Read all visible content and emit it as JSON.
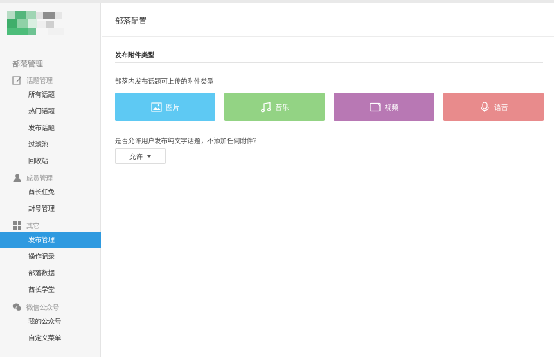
{
  "sidebar": {
    "title": "部落管理",
    "groups": [
      {
        "label": "话题管理",
        "icon": "edit-icon"
      },
      {
        "label": "成员管理",
        "icon": "user-icon"
      },
      {
        "label": "其它",
        "icon": "grid-icon"
      },
      {
        "label": "微信公众号",
        "icon": "wechat-icon"
      }
    ],
    "items": [
      "所有话题",
      "热门话题",
      "发布话题",
      "过滤池",
      "回收站",
      "酋长任免",
      "封号管理",
      "发布管理",
      "操作记录",
      "部落数据",
      "酋长学堂",
      "我的公众号",
      "自定义菜单"
    ],
    "active_item": "发布管理"
  },
  "main": {
    "title": "部落配置",
    "section_title": "发布附件类型",
    "description": "部落内发布话题可上传的附件类型",
    "types": [
      {
        "label": "图片",
        "icon": "image-icon",
        "color": "#5ec9f3"
      },
      {
        "label": "音乐",
        "icon": "music-icon",
        "color": "#93d384"
      },
      {
        "label": "视频",
        "icon": "video-icon",
        "color": "#b878b4"
      },
      {
        "label": "语音",
        "icon": "microphone-icon",
        "color": "#e88b8c"
      }
    ],
    "question": "是否允许用户发布纯文字话题，不添加任何附件？",
    "select_value": "允许"
  },
  "colors": {
    "accent": "#2f9ae0",
    "sidebar_bg": "#f6f6f6"
  }
}
